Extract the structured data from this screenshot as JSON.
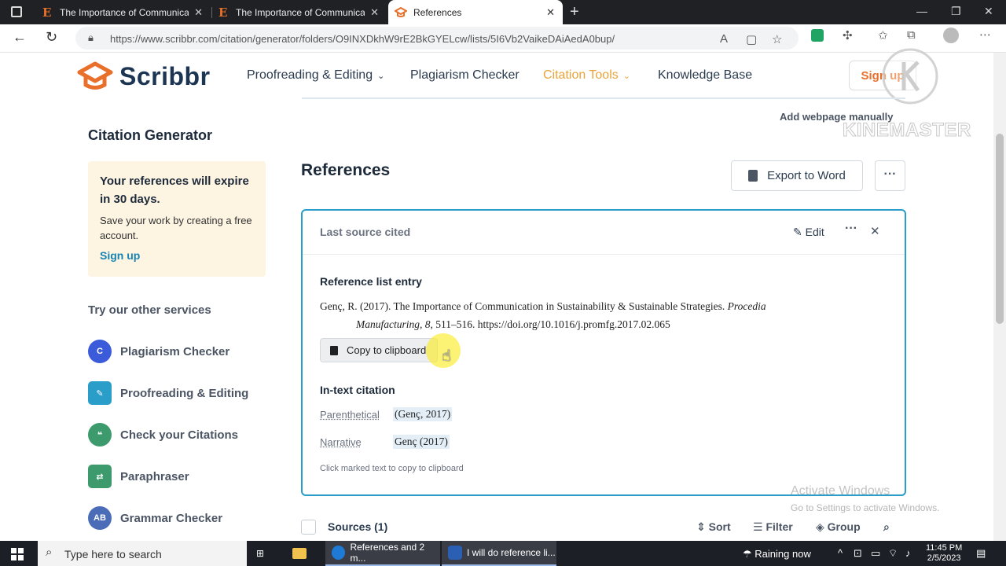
{
  "browser": {
    "tabs": [
      {
        "label": "The Importance of Communicatio",
        "icon": "E"
      },
      {
        "label": "The Importance of Communicatio",
        "icon": "E"
      },
      {
        "label": "References",
        "icon": "scribbr-icon"
      }
    ],
    "url": "https://www.scribbr.com/citation/generator/folders/O9INXDkhW9rE2BkGYELcw/lists/5I6Vb2VaikeDAiAedA0bup/"
  },
  "header": {
    "logo_text": "Scribbr",
    "nav": {
      "proofreading": "Proofreading & Editing",
      "plagiarism": "Plagiarism Checker",
      "citation_tools": "Citation Tools",
      "knowledge_base": "Knowledge Base"
    },
    "signup": "Sign up"
  },
  "sidebar": {
    "title": "Citation Generator",
    "expire_heading": "Your references will expire in 30 days.",
    "expire_text": "Save your work by creating a free account.",
    "signup_link": "Sign up",
    "services_title": "Try our other services",
    "services": [
      {
        "label": "Plagiarism Checker",
        "badge": "C",
        "color": "#3b5bdb"
      },
      {
        "label": "Proofreading & Editing",
        "badge": "✎",
        "color": "#2a9dc8"
      },
      {
        "label": "Check your Citations",
        "badge": "❝",
        "color": "#3d9a6c"
      },
      {
        "label": "Paraphraser",
        "badge": "⇄",
        "color": "#3d9a6c"
      },
      {
        "label": "Grammar Checker",
        "badge": "AB",
        "color": "#4b6cb7"
      }
    ]
  },
  "main": {
    "add_webpage": "Add webpage manually",
    "title": "References",
    "export_label": "Export to Word",
    "more_label": "···",
    "card": {
      "title": "Last source cited",
      "edit_label": "Edit",
      "more_label": "···",
      "close_label": "✕",
      "entry_heading": "Reference list entry",
      "entry_line1_prefix": "Genç, R. (2017). The Importance of Communication in Sustainability & Sustainable Strategies.",
      "entry_journal": "Procedia",
      "entry_line2_journal": "Manufacturing",
      "entry_line2_vol": "8",
      "entry_line2_rest": ", 511–516. https://doi.org/10.1016/j.promfg.2017.02.065",
      "copy_label": "Copy to clipboard",
      "intext_heading": "In-text citation",
      "parenthetical_label": "Parenthetical",
      "parenthetical_value": "(Genç, 2017)",
      "narrative_label": "Narrative",
      "narrative_value": "Genç (2017)",
      "hint": "Click marked text to copy to clipboard"
    },
    "sources": {
      "label": "Sources (1)",
      "sort": "Sort",
      "filter": "Filter",
      "group": "Group"
    }
  },
  "overlay": {
    "watermark": "KINEMASTER",
    "activate_title": "Activate Windows",
    "activate_sub": "Go to Settings to activate Windows."
  },
  "taskbar": {
    "search_placeholder": "Type here to search",
    "apps": [
      {
        "label": "References and 2 m..."
      },
      {
        "label": "I will do reference li..."
      }
    ],
    "weather": "Raining now",
    "time": "11:45 PM",
    "date": "2/5/2023"
  }
}
